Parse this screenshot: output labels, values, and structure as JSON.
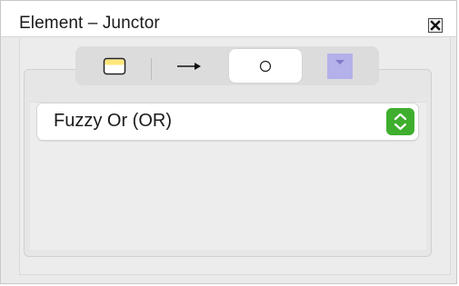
{
  "window": {
    "title": "Element – Junctor"
  },
  "tabs": [
    {
      "name": "tab-node-style",
      "icon": "node-box-icon",
      "selected": false
    },
    {
      "name": "tab-edge-style",
      "icon": "arrow-right-icon",
      "selected": false
    },
    {
      "name": "tab-junctor",
      "icon": "circle-icon",
      "selected": true
    },
    {
      "name": "tab-color",
      "icon": "color-swatch-icon",
      "selected": false
    }
  ],
  "junctor_select": {
    "value": "Fuzzy Or (OR)"
  },
  "colors": {
    "accent_green": "#3fae2e",
    "swatch_lavender": "#b3b0ea",
    "node_yellow": "#ffe77a"
  }
}
